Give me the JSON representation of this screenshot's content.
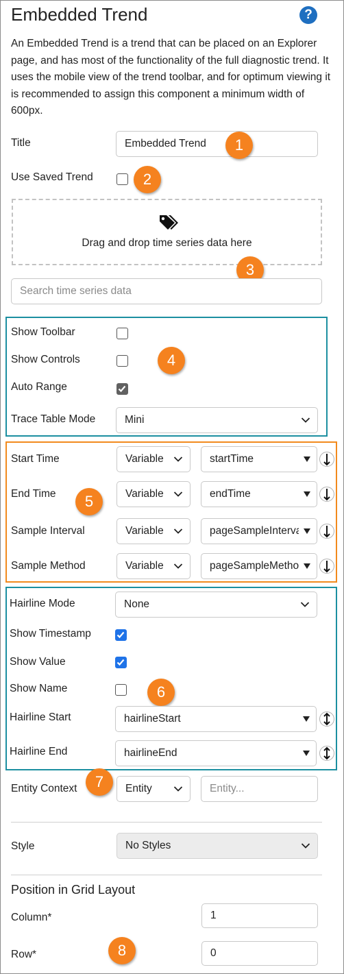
{
  "header": {
    "title": "Embedded Trend",
    "help_icon": "?",
    "description": "An Embedded Trend is a trend that can be placed on an Explorer page, and has most of the functionality of the full diagnostic trend. It uses the mobile view of the trend toolbar, and for optimum viewing it is recommended to assign this component a minimum width of 600px."
  },
  "fields": {
    "title_label": "Title",
    "title_value": "Embedded Trend",
    "use_saved_trend_label": "Use Saved Trend",
    "use_saved_trend_checked": false,
    "drop_zone_text": "Drag and drop time series data here",
    "search_placeholder": "Search time series data"
  },
  "group4": {
    "show_toolbar_label": "Show Toolbar",
    "show_toolbar_checked": false,
    "show_controls_label": "Show Controls",
    "show_controls_checked": false,
    "auto_range_label": "Auto Range",
    "auto_range_checked": true,
    "trace_table_mode_label": "Trace Table Mode",
    "trace_table_mode_value": "Mini"
  },
  "group5": {
    "rows": [
      {
        "label": "Start Time",
        "source": "Variable",
        "variable": "startTime"
      },
      {
        "label": "End Time",
        "source": "Variable",
        "variable": "endTime"
      },
      {
        "label": "Sample Interval",
        "source": "Variable",
        "variable": "pageSampleInterval"
      },
      {
        "label": "Sample Method",
        "source": "Variable",
        "variable": "pageSampleMethod"
      }
    ]
  },
  "group6": {
    "hairline_mode_label": "Hairline Mode",
    "hairline_mode_value": "None",
    "show_timestamp_label": "Show Timestamp",
    "show_timestamp_checked": true,
    "show_value_label": "Show Value",
    "show_value_checked": true,
    "show_name_label": "Show Name",
    "show_name_checked": false,
    "hairline_start_label": "Hairline Start",
    "hairline_start_value": "hairlineStart",
    "hairline_end_label": "Hairline End",
    "hairline_end_value": "hairlineEnd"
  },
  "entity": {
    "label": "Entity Context",
    "source": "Entity",
    "placeholder": "Entity..."
  },
  "style": {
    "label": "Style",
    "value": "No Styles"
  },
  "grid": {
    "heading": "Position in Grid Layout",
    "column_label": "Column*",
    "column_value": "1",
    "row_label": "Row*",
    "row_value": "0"
  },
  "callouts": [
    "1",
    "2",
    "3",
    "4",
    "5",
    "6",
    "7",
    "8"
  ],
  "colors": {
    "teal_box": "#1b8fa0",
    "orange_box": "#f28a1d",
    "badge": "#f5821f",
    "help": "#1f6fc0",
    "checkbox_blue": "#1f73e8",
    "checkbox_grey": "#616161"
  }
}
